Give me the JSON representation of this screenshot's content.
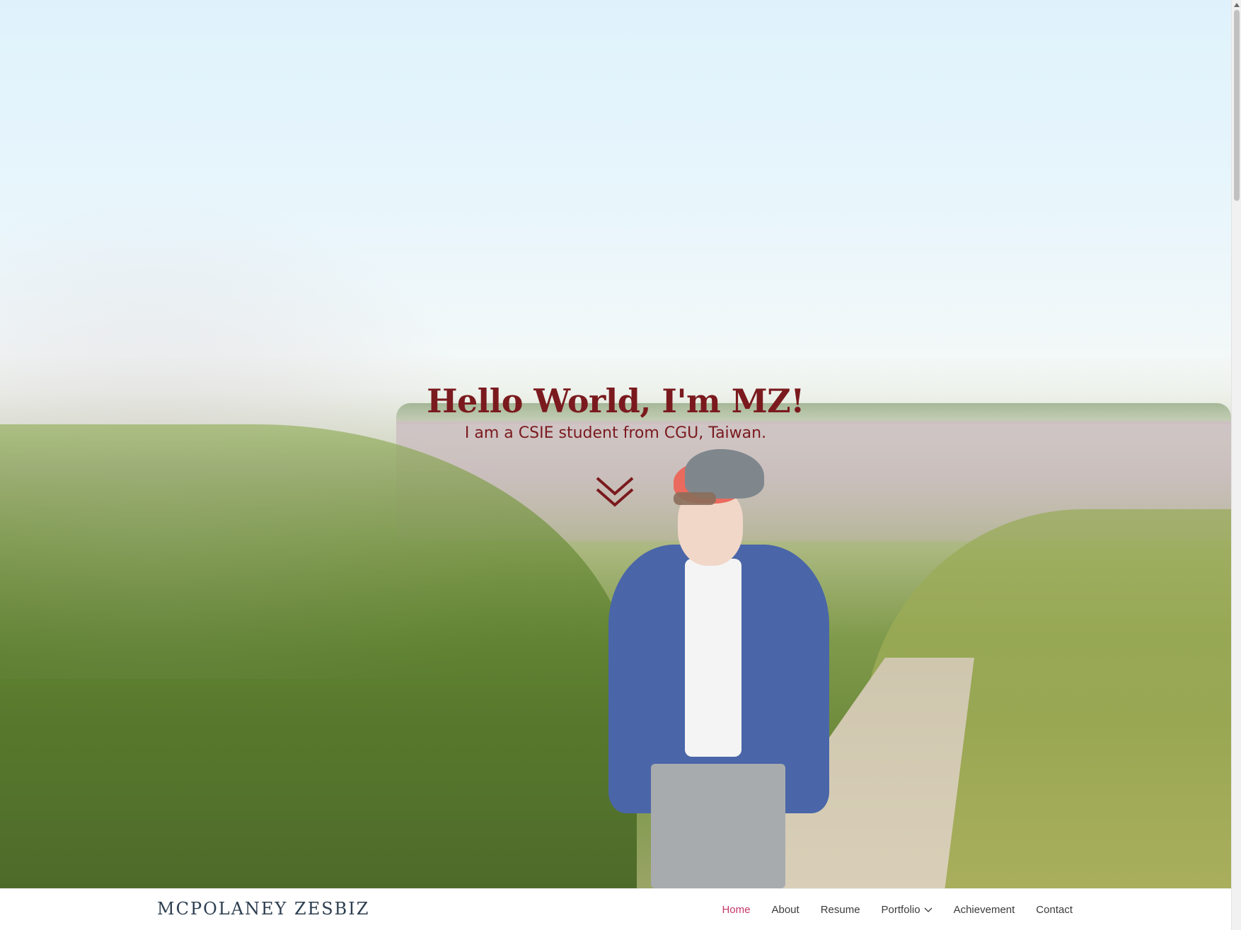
{
  "hero": {
    "title": "Hello World, I'm MZ!",
    "subtitle": "I am a CSIE student from CGU, Taiwan.",
    "scroll_icon": "double-chevron-down-icon",
    "text_color": "#7a1a1e"
  },
  "navbar": {
    "brand": "MCPOLANEY ZESBIZ",
    "items": [
      {
        "label": "Home",
        "active": true
      },
      {
        "label": "About",
        "active": false
      },
      {
        "label": "Resume",
        "active": false
      },
      {
        "label": "Portfolio",
        "active": false,
        "has_dropdown": true
      },
      {
        "label": "Achievement",
        "active": false
      },
      {
        "label": "Contact",
        "active": false
      }
    ],
    "active_color": "#c2386a",
    "brand_color": "#2d3e50"
  }
}
